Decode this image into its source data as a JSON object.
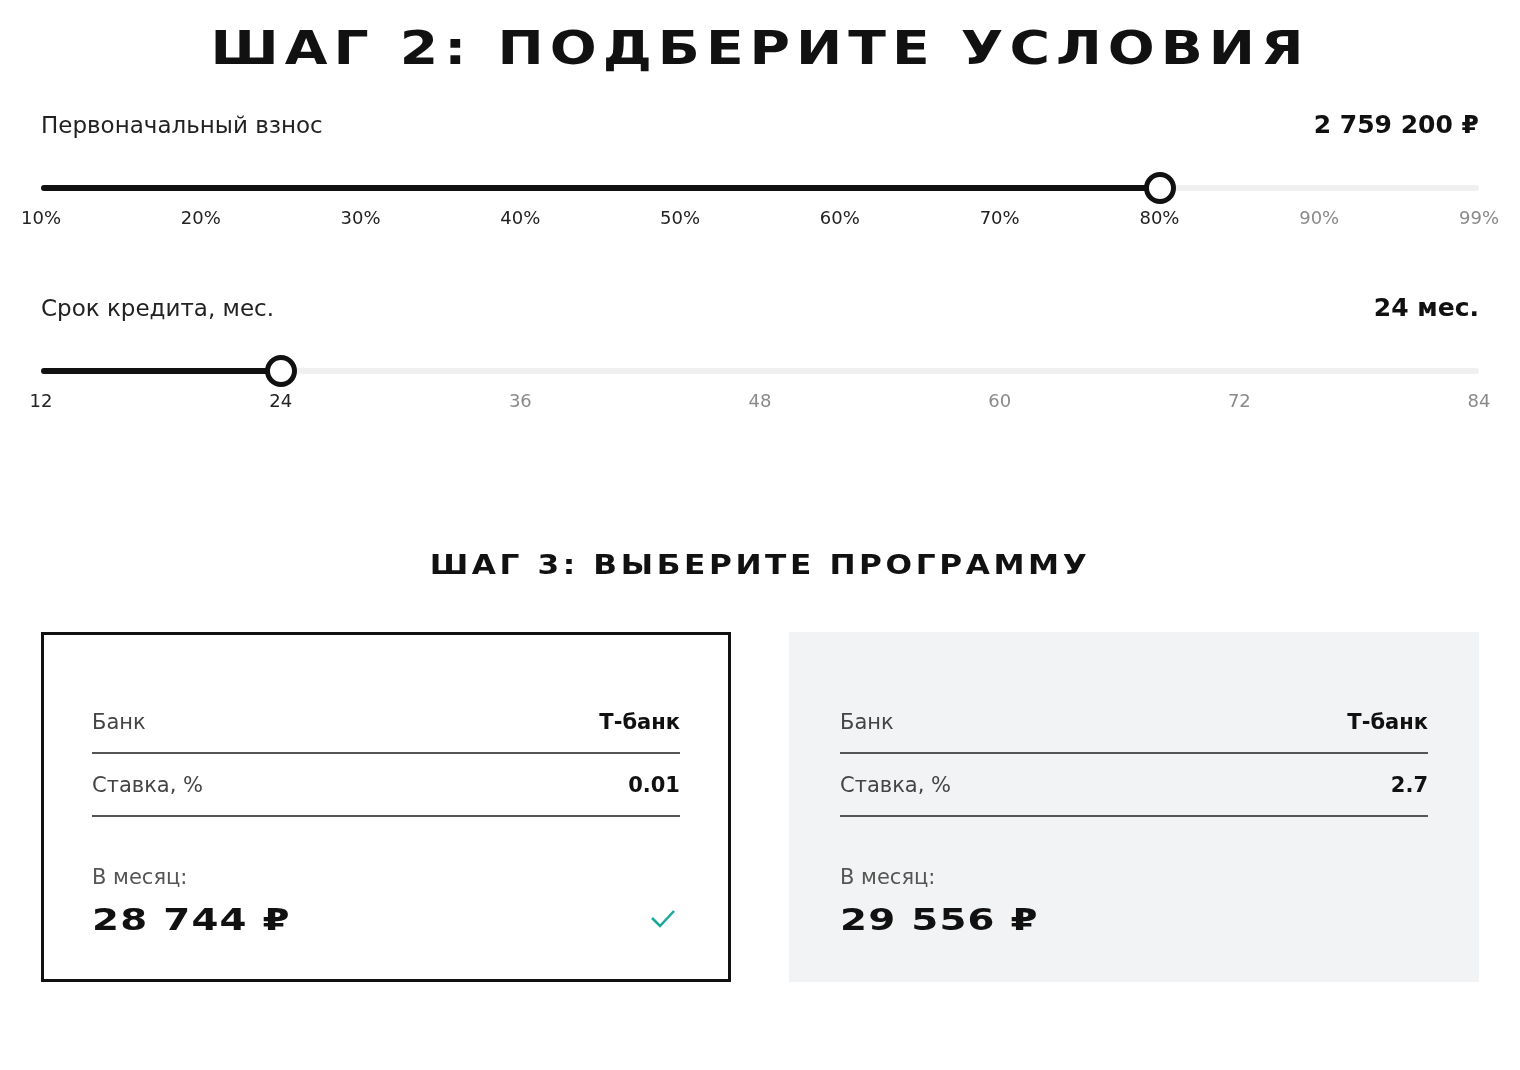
{
  "title": "ШАГ 2: ПОДБЕРИТЕ УСЛОВИЯ",
  "sliders": [
    {
      "label": "Первоначальный взнос",
      "value": "2 759 200 ₽",
      "level": 0.778,
      "ticks": [
        "10%",
        "20%",
        "30%",
        "40%",
        "50%",
        "60%",
        "70%",
        "80%",
        "90%",
        "99%"
      ]
    },
    {
      "label": "Срок кредита, мес.",
      "value": "24 мес.",
      "level": 0.1667,
      "ticks": [
        "12",
        "24",
        "36",
        "48",
        "60",
        "72",
        "84"
      ]
    }
  ],
  "step3_title": "ШАГ 3: ВЫБЕРИТЕ ПРОГРАММУ",
  "programs": [
    {
      "selected": true,
      "rows": [
        {
          "label": "Банк",
          "value": "Т-банк"
        },
        {
          "label": "Ставка, %",
          "value": "0.01"
        }
      ],
      "monthly_label": "В месяц:",
      "monthly": "28 744 ₽"
    },
    {
      "selected": false,
      "rows": [
        {
          "label": "Банк",
          "value": "Т-банк"
        },
        {
          "label": "Ставка, %",
          "value": "2.7"
        }
      ],
      "monthly_label": "В месяц:",
      "monthly": "29 556 ₽"
    }
  ]
}
